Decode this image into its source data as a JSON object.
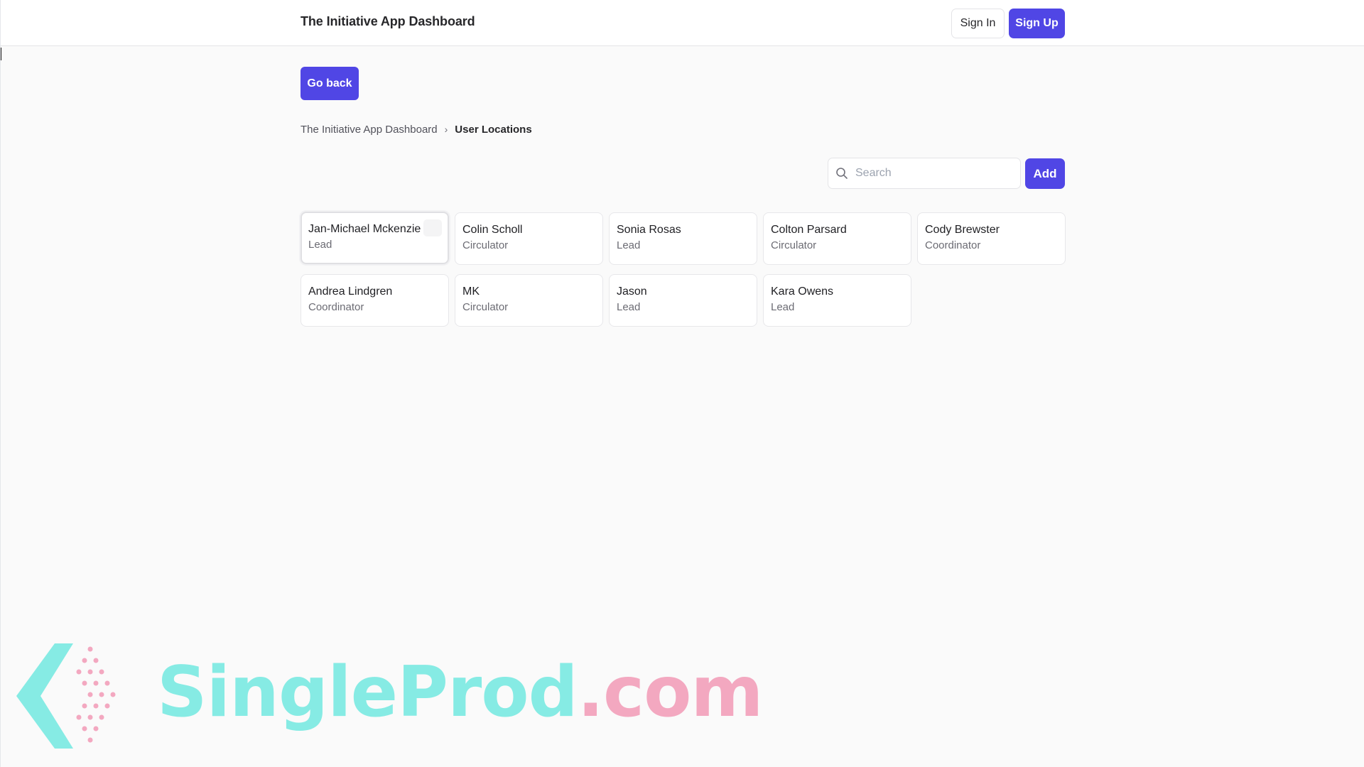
{
  "header": {
    "title": "The Initiative App Dashboard",
    "signin_label": "Sign In",
    "signup_label": "Sign Up"
  },
  "back_label": "Go back",
  "breadcrumb": {
    "root": "The Initiative App Dashboard",
    "separator": "›",
    "current": "User Locations"
  },
  "search": {
    "placeholder": "Search",
    "value": ""
  },
  "add_label": "Add",
  "users": [
    {
      "name": "Jan-Michael Mckenzie",
      "role": "Lead"
    },
    {
      "name": "Colin Scholl",
      "role": "Circulator"
    },
    {
      "name": "Sonia Rosas",
      "role": "Lead"
    },
    {
      "name": "Colton Parsard",
      "role": "Circulator"
    },
    {
      "name": "Cody Brewster",
      "role": "Coordinator"
    },
    {
      "name": "Andrea Lindgren",
      "role": "Coordinator"
    },
    {
      "name": "MK",
      "role": "Circulator"
    },
    {
      "name": "Jason",
      "role": "Lead"
    },
    {
      "name": "Kara Owens",
      "role": "Lead"
    }
  ],
  "watermark": {
    "brand": "SingleProd",
    "tld": ".com"
  },
  "colors": {
    "primary": "#5046e5",
    "background": "#fafafa",
    "watermark_teal": "#86ebe4",
    "watermark_pink": "#f3a8c0"
  }
}
